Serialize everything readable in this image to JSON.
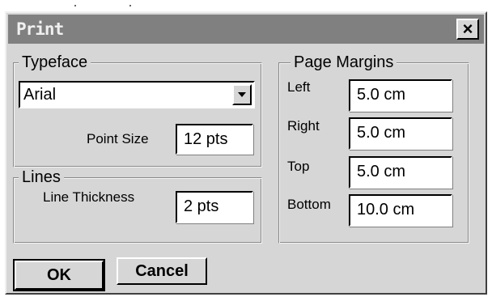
{
  "window": {
    "title": "Print",
    "close_glyph": "×"
  },
  "typeface": {
    "legend": "Typeface",
    "font_selected": "Arial",
    "point_size_label": "Point Size",
    "point_size_value": "12  pts"
  },
  "lines": {
    "legend": "Lines",
    "thickness_label": "Line Thickness",
    "thickness_value": "2  pts"
  },
  "margins": {
    "legend": "Page Margins",
    "fields": [
      {
        "label": "Left",
        "value": "5.0 cm"
      },
      {
        "label": "Right",
        "value": "5.0 cm"
      },
      {
        "label": "Top",
        "value": "5.0 cm"
      },
      {
        "label": "Bottom",
        "value": "10.0 cm"
      }
    ]
  },
  "buttons": {
    "ok": "OK",
    "cancel": "Cancel"
  },
  "icons": {
    "close": "close-icon",
    "dropdown": "chevron-down-icon"
  }
}
